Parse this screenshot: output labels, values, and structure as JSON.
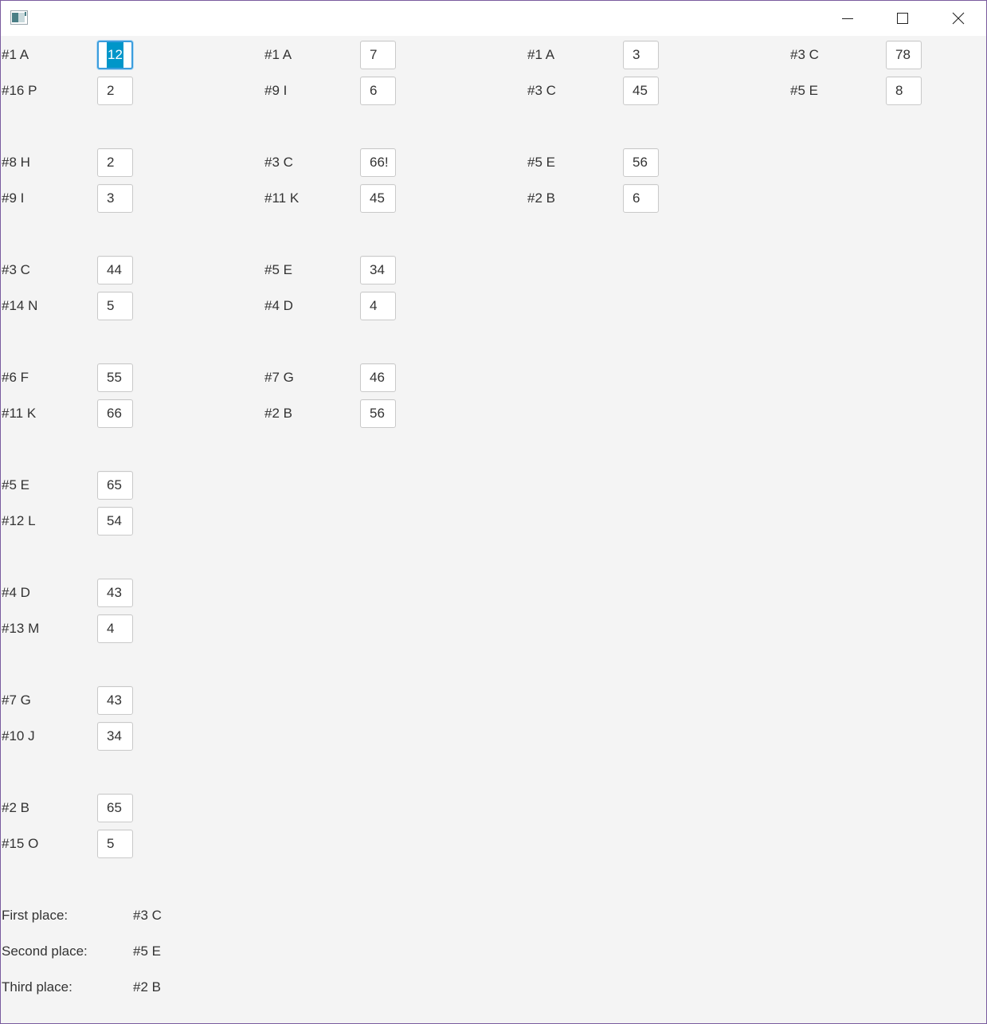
{
  "window": {
    "minimize_icon": "minimize-icon",
    "maximize_icon": "maximize-icon",
    "close_icon": "close-icon",
    "app_icon": "app-icon"
  },
  "groups": [
    {
      "columns": [
        [
          {
            "label": "#1 A",
            "value": "12"
          },
          {
            "label": "#16 P",
            "value": "2"
          }
        ],
        [
          {
            "label": "#1 A",
            "value": "7"
          },
          {
            "label": "#9 I",
            "value": "6"
          }
        ],
        [
          {
            "label": "#1 A",
            "value": "3"
          },
          {
            "label": "#3 C",
            "value": "45"
          }
        ],
        [
          {
            "label": "#3 C",
            "value": "78"
          },
          {
            "label": "#5 E",
            "value": "8"
          }
        ]
      ]
    },
    {
      "columns": [
        [
          {
            "label": "#8 H",
            "value": "2"
          },
          {
            "label": "#9 I",
            "value": "3"
          }
        ],
        [
          {
            "label": "#3 C",
            "value": "66!"
          },
          {
            "label": "#11 K",
            "value": "45"
          }
        ],
        [
          {
            "label": "#5 E",
            "value": "56"
          },
          {
            "label": "#2 B",
            "value": "6"
          }
        ]
      ]
    },
    {
      "columns": [
        [
          {
            "label": "#3 C",
            "value": "44"
          },
          {
            "label": "#14 N",
            "value": "5"
          }
        ],
        [
          {
            "label": "#5 E",
            "value": "34"
          },
          {
            "label": "#4 D",
            "value": "4"
          }
        ]
      ]
    },
    {
      "columns": [
        [
          {
            "label": "#6 F",
            "value": "55"
          },
          {
            "label": "#11 K",
            "value": "66"
          }
        ],
        [
          {
            "label": "#7 G",
            "value": "46"
          },
          {
            "label": "#2 B",
            "value": "56"
          }
        ]
      ]
    },
    {
      "columns": [
        [
          {
            "label": "#5 E",
            "value": "65"
          },
          {
            "label": "#12 L",
            "value": "54"
          }
        ]
      ]
    },
    {
      "columns": [
        [
          {
            "label": "#4 D",
            "value": "43"
          },
          {
            "label": "#13 M",
            "value": "4"
          }
        ]
      ]
    },
    {
      "columns": [
        [
          {
            "label": "#7 G",
            "value": "43"
          },
          {
            "label": "#10 J",
            "value": "34"
          }
        ]
      ]
    },
    {
      "columns": [
        [
          {
            "label": "#2 B",
            "value": "65"
          },
          {
            "label": "#15 O",
            "value": "5"
          }
        ]
      ]
    }
  ],
  "results": [
    {
      "label": "First place:",
      "value": "#3 C"
    },
    {
      "label": "Second place:",
      "value": "#5 E"
    },
    {
      "label": "Third place:",
      "value": "#2 B"
    }
  ],
  "colors": {
    "focus_border": "#3b9ddd",
    "selection": "#0096c9",
    "window_border": "#7a5c9e",
    "background": "#f4f4f4"
  }
}
